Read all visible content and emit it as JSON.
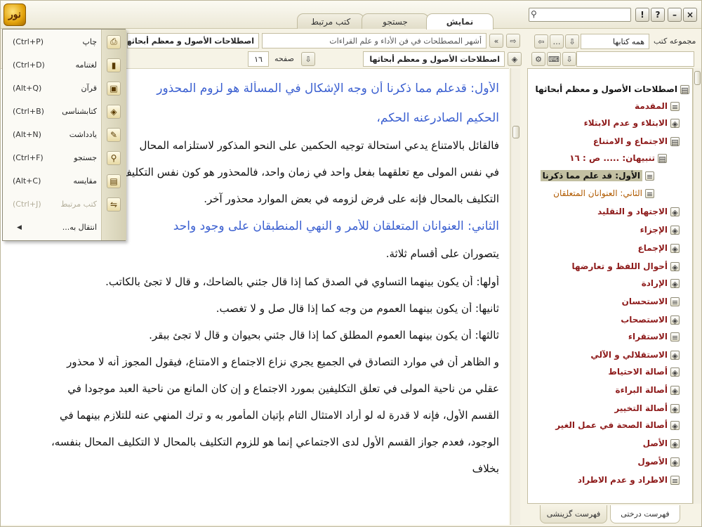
{
  "app": {
    "logo_text": "نور",
    "tabs": [
      "نمایش",
      "جستجو",
      "کتب مرتبط"
    ],
    "search_placeholder": ""
  },
  "window_buttons": {
    "help": "?",
    "info": "!",
    "minimize": "–",
    "close": "×"
  },
  "reader_toolbar": {
    "title_left": "اصطلاحات الأصول و معظم أبحاثها",
    "title_right": "أشهر المصطلحات في فن الأداء و علم القراءات",
    "book_select": "اصطلاحات الأصول و معظم أبحاثها",
    "page_label": "صفحه",
    "page_value": "١٦"
  },
  "right_toolbar": {
    "group_label": "مجموعه کتب",
    "group_value": "همه کتابها"
  },
  "text_lines": [
    "الأول: قدعلم مما ذكرنا أن وجه الإشكال في المسألة هو لزوم المحذور",
    "الحكيم الصادرعنه الحكم،",
    "فالقائل بالامتناع يدعي استحالة توجيه الحكمين على النحو المذكور لاستلزامه المحال",
    "في نفس المولى مع تعلقهما بفعل واحد في زمان واحد، فالمحذور هو كون نفس التكليف",
    "التكليف بالمحال فإنه على فرض لزومه في بعض الموارد محذور آخر.",
    "الثاني: العنوانان المتعلقان للأمر و النهي المنطبقان على وجود واحد",
    "يتصوران على أقسام ثلاثة.",
    "أولها: أن يكون بينهما التساوي في الصدق كما إذا قال جئني بالضاحك، و قال لا تجئ بالكاتب.",
    "ثانيها: أن يكون بينهما العموم من وجه كما إذا قال صل و لا تغصب.",
    "ثالثها: أن يكون بينهما العموم المطلق كما إذا قال جئني بحيوان و قال لا تجئ ببقر.",
    "و الظاهر أن في موارد التصادق في الجميع يجري نزاع الاجتماع و الامتناع، فيقول المجوز أنه لا محذور",
    "عقلي من ناحية المولى في تعلق التكليفين بمورد الاجتماع و إن كان المانع من ناحية العبد موجودا في",
    "القسم الأول، فإنه لا قدرة له لو أراد الامتثال التام بإتيان المأمور به و ترك المنهي عنه للتلازم بينهما في",
    "الوجود، فعدم جواز القسم الأول لدى الاجتماعي إنما هو للزوم التكليف بالمحال لا التكليف المحال بنفسه،",
    "بخلاف"
  ],
  "tree": [
    {
      "label": "اصطلاحات الأصول و معظم أبحاثها",
      "style": "root",
      "icon": "book-icon"
    },
    {
      "label": "المقدمة",
      "style": "normal",
      "icon": "page-icon"
    },
    {
      "label": "الابتلاء و عدم الابتلاء",
      "style": "normal",
      "icon": "tag-icon"
    },
    {
      "label": "الاجتماع و الامتناع",
      "style": "normal",
      "icon": "book-icon"
    },
    {
      "label": "تنبيهان: ..... ص : ١٦",
      "style": "normal",
      "icon": "book-icon"
    },
    {
      "label": "الأول: قد علم مما ذكرنا",
      "style": "sel",
      "icon": "page-icon"
    },
    {
      "label": "الثاني: العنوانان المتعلقان",
      "style": "orange",
      "icon": "page-icon"
    },
    {
      "label": "الاجتهاد و التقليد",
      "style": "normal",
      "icon": "tag-icon"
    },
    {
      "label": "الإجزاء",
      "style": "normal",
      "icon": "tag-icon"
    },
    {
      "label": "الإجماع",
      "style": "normal",
      "icon": "tag-icon"
    },
    {
      "label": "أحوال اللفظ و تعارضها",
      "style": "normal",
      "icon": "tag-icon"
    },
    {
      "label": "الإرادة",
      "style": "normal",
      "icon": "tag-icon"
    },
    {
      "label": "الاستحسان",
      "style": "normal",
      "icon": "page-icon"
    },
    {
      "label": "الاستصحاب",
      "style": "normal",
      "icon": "tag-icon"
    },
    {
      "label": "الاستقراء",
      "style": "normal",
      "icon": "page-icon"
    },
    {
      "label": "الاستقلالي و الآلي",
      "style": "normal",
      "icon": "tag-icon"
    },
    {
      "label": "أصالة الاحتياط",
      "style": "normal",
      "icon": "tag-icon"
    },
    {
      "label": "أصالة البراءة",
      "style": "normal",
      "icon": "tag-icon"
    },
    {
      "label": "أصالة التخيير",
      "style": "normal",
      "icon": "tag-icon"
    },
    {
      "label": "أصالة الصحة في عمل الغير",
      "style": "normal",
      "icon": "tag-icon"
    },
    {
      "label": "الأصل",
      "style": "normal",
      "icon": "tag-icon"
    },
    {
      "label": "الأصول",
      "style": "normal",
      "icon": "tag-icon"
    },
    {
      "label": "الاطراد و عدم الاطراد",
      "style": "normal",
      "icon": "page-icon"
    }
  ],
  "bottom_tabs": [
    "فهرست درختی",
    "فهرست گزینشی"
  ],
  "menu": [
    {
      "label": "چاپ",
      "shortcut": "(Ctrl+P)",
      "icon": "printer-icon",
      "enabled": true
    },
    {
      "label": "لغتنامه",
      "shortcut": "(Ctrl+D)",
      "icon": "dictionary-icon",
      "enabled": true
    },
    {
      "label": "قرآن",
      "shortcut": "(Alt+Q)",
      "icon": "quran-icon",
      "enabled": true
    },
    {
      "label": "کتابشناسی",
      "shortcut": "(Ctrl+B)",
      "icon": "bibliography-icon",
      "enabled": true
    },
    {
      "label": "یادداشت",
      "shortcut": "(Alt+N)",
      "icon": "note-icon",
      "enabled": true
    },
    {
      "label": "جستجو",
      "shortcut": "(Ctrl+F)",
      "icon": "search-icon",
      "enabled": true
    },
    {
      "label": "مقایسه",
      "shortcut": "(Alt+C)",
      "icon": "compare-icon",
      "enabled": true
    },
    {
      "label": "کتب مرتبط",
      "shortcut": "(Ctrl+J)",
      "icon": "linked-books-icon",
      "enabled": false
    },
    {
      "label": "انتقال به...",
      "shortcut": "",
      "icon": "",
      "enabled": true
    }
  ]
}
